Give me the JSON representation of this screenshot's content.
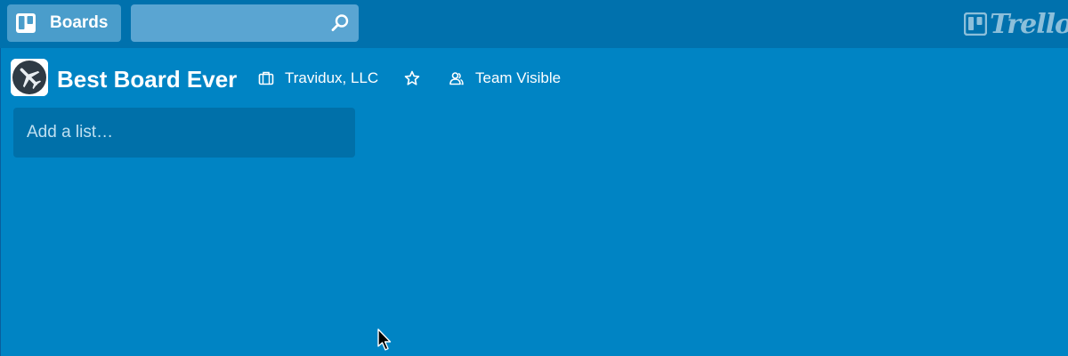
{
  "topbar": {
    "boards_label": "Boards",
    "boards_icon": "boards-icon",
    "search": {
      "value": "",
      "placeholder": "",
      "icon": "search-icon"
    },
    "logo_text": "Trello"
  },
  "board": {
    "title": "Best Board Ever",
    "avatar_icon": "airplane-icon",
    "organization": "Travidux, LLC",
    "organization_icon": "briefcase-icon",
    "star_icon": "star-icon",
    "visibility": "Team Visible",
    "visibility_icon": "team-icon"
  },
  "lists": {
    "add_list_label": "Add a list…"
  },
  "colors": {
    "board_background": "#0084c4",
    "topbar_background": "#0071ad",
    "add_list_background": "#0070a9"
  }
}
